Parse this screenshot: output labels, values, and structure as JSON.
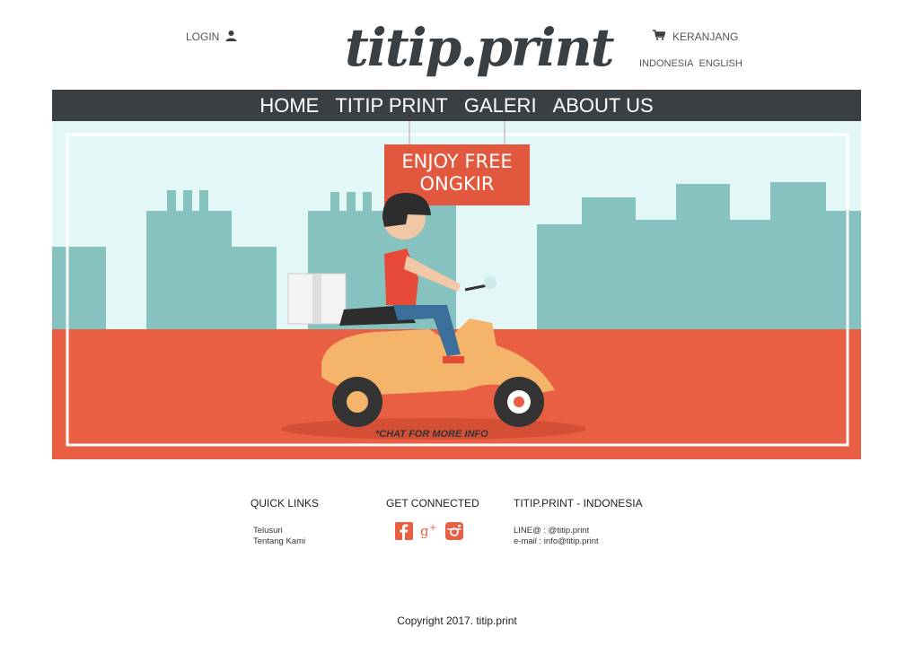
{
  "header": {
    "login_label": "LOGIN",
    "logo_text": "titip.print",
    "cart_label": "KERANJANG",
    "languages": [
      "INDONESIA",
      "ENGLISH"
    ]
  },
  "nav": {
    "items": [
      "HOME",
      "TITIP PRINT",
      "GALERI",
      "ABOUT US"
    ]
  },
  "banner": {
    "sign_line1": "ENJOY FREE",
    "sign_line2": "ONGKIR",
    "caption": "*CHAT FOR MORE INFO"
  },
  "footer": {
    "quick_links_title": "QUICK LINKS",
    "quick_links": [
      "Telusuri",
      "Tentang Kami"
    ],
    "get_connected_title": "GET CONNECTED",
    "social_icons": [
      "facebook-icon",
      "google-plus-icon",
      "instagram-icon"
    ],
    "company_title": "TITIP.PRINT - INDONESIA",
    "contact_line": "LINE@ : @titip.print",
    "email_line": "e-mail  : info@titip.print",
    "copyright": "Copyright 2017. titip.print"
  },
  "colors": {
    "nav_bg": "#3a3f44",
    "sky": "#e3f7f7",
    "buildings": "#86c2bf",
    "road": "#e95f43",
    "sign": "#e2583e",
    "scooter": "#f4b56a"
  }
}
